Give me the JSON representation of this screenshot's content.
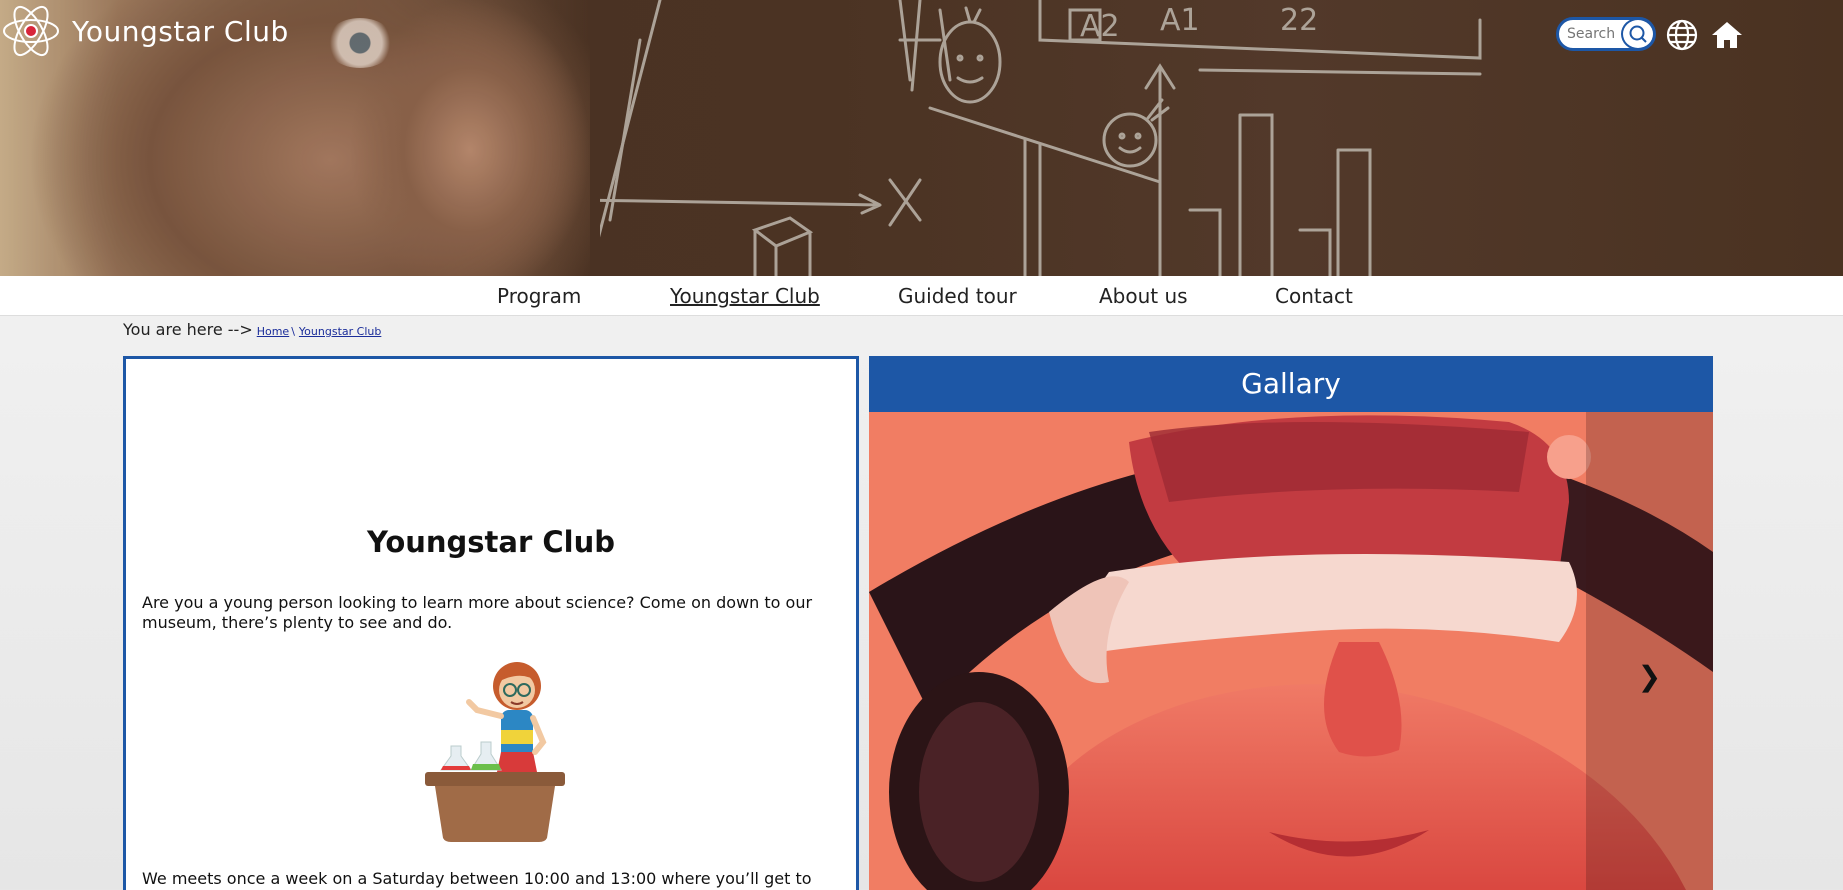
{
  "header": {
    "site_title": "Youngstar Club",
    "search_placeholder": "Search",
    "icons": [
      "atom-logo-icon",
      "search-icon",
      "globe-icon",
      "home-icon"
    ]
  },
  "nav": {
    "items": [
      {
        "label": "Program"
      },
      {
        "label": "Youngstar Club",
        "active": true
      },
      {
        "label": "Guided tour"
      },
      {
        "label": "About us"
      },
      {
        "label": "Contact"
      }
    ]
  },
  "breadcrumb": {
    "prefix": "You are here -->",
    "links": [
      "Home",
      "Youngstar Club"
    ],
    "separator": "\\"
  },
  "content": {
    "title": "Youngstar Club",
    "intro": "Are you a young person looking to learn more about science? Come on down to our museum, there’s plenty to see and do.",
    "schedule": "We meets once a week on a Saturday between 10:00 and 13:00 where you’ll get to explore and"
  },
  "gallery": {
    "title": "Gallary",
    "next_label": "❯"
  },
  "colors": {
    "accent": "#1d57a6",
    "hero": "#4b3323",
    "gallery_image": "#ee5a4b"
  }
}
